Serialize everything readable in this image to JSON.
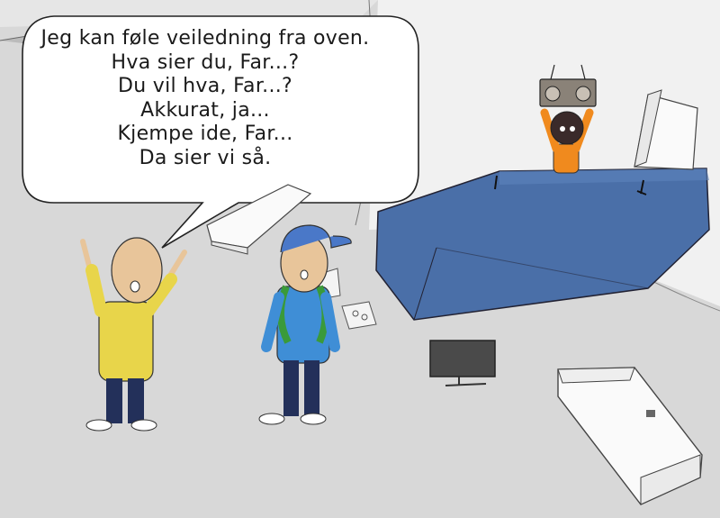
{
  "speech_bubble": {
    "lines": [
      "Jeg kan føle veiledning fra oven.",
      "Hva sier du, Far...?",
      "Du vil hva, Far...?",
      "Akkurat, ja...",
      "Kjempe ide, Far...",
      "Da sier vi så."
    ]
  },
  "colors": {
    "floor": "#d9d9d9",
    "back_wall": "#f0f0f0",
    "blue_car": "#4a6fa8",
    "yellow_shirt": "#e8d54a",
    "blue_shirt": "#3f8ed6",
    "blue_cap": "#4a78c8",
    "green_backpack": "#3a9a3a",
    "orange_shirt": "#f08a1e",
    "trousers": "#23305a"
  }
}
